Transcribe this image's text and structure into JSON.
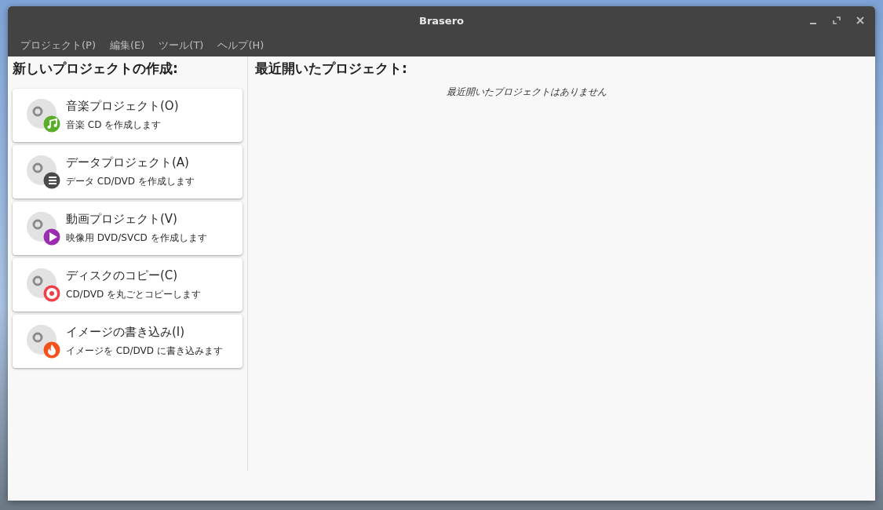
{
  "window": {
    "title": "Brasero"
  },
  "menu": [
    "プロジェクト(P)",
    "編集(E)",
    "ツール(T)",
    "ヘルプ(H)"
  ],
  "new_project": {
    "heading": "新しいプロジェクトの作成:",
    "items": [
      {
        "kind": "audio",
        "title": "音楽プロジェクト(O)",
        "description": "音楽 CD を作成します",
        "color": "#5aad2a"
      },
      {
        "kind": "data",
        "title": "データプロジェクト(A)",
        "description": "データ CD/DVD を作成します",
        "color": "#4a4a4a"
      },
      {
        "kind": "video",
        "title": "動画プロジェクト(V)",
        "description": "映像用 DVD/SVCD を作成します",
        "color": "#9b2db0"
      },
      {
        "kind": "copy",
        "title": "ディスクのコピー(C)",
        "description": "CD/DVD を丸ごとコピーします",
        "color": "#f0404a"
      },
      {
        "kind": "burn",
        "title": "イメージの書き込み(I)",
        "description": "イメージを CD/DVD に書き込みます",
        "color": "#f4511e"
      }
    ]
  },
  "recent": {
    "heading": "最近開いたプロジェクト:",
    "empty_message": "最近開いたプロジェクトはありません"
  }
}
